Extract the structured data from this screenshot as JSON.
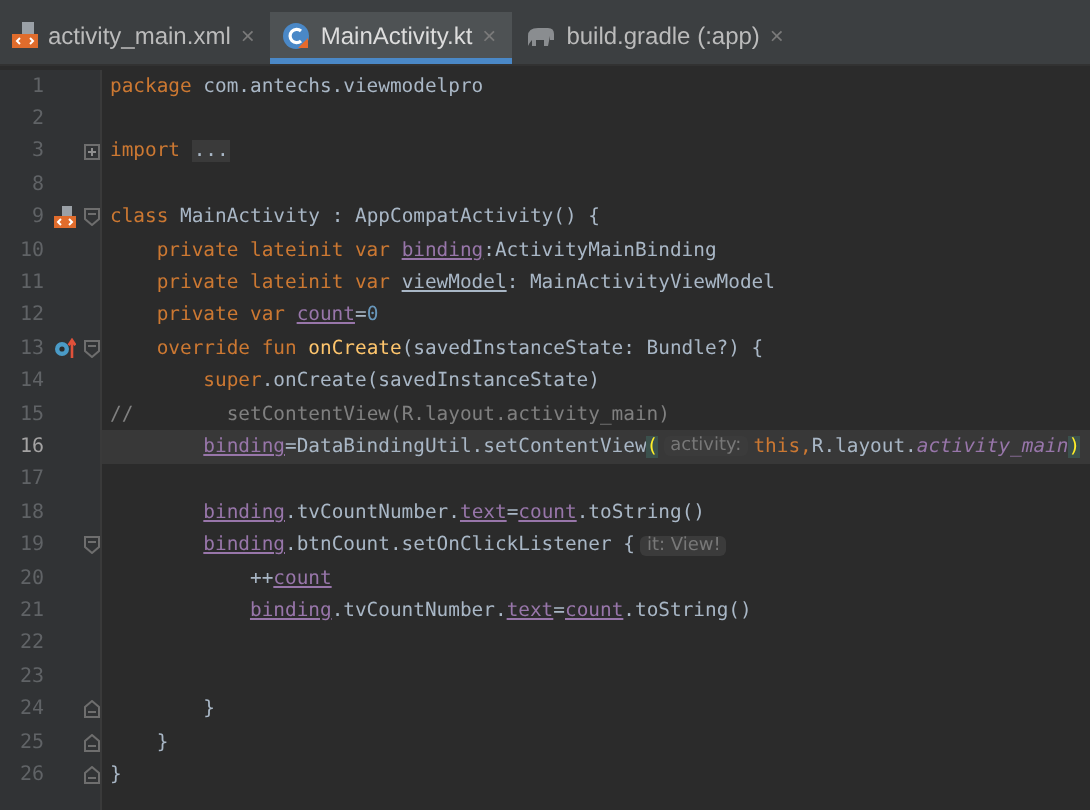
{
  "tabs": [
    {
      "label": "activity_main.xml",
      "kind": "layout",
      "close": "×",
      "selected": false
    },
    {
      "label": "MainActivity.kt",
      "kind": "kotlin",
      "close": "×",
      "selected": true
    },
    {
      "label": "build.gradle (:app)",
      "kind": "gradle",
      "close": "×",
      "selected": false
    }
  ],
  "lines": [
    {
      "num": "1",
      "current": false,
      "tokens": [
        {
          "kind": "kw",
          "text": "package"
        },
        {
          "kind": "space"
        },
        {
          "kind": "plain",
          "text": "com.antechs.viewmodelpro"
        }
      ]
    },
    {
      "num": "2",
      "current": false
    },
    {
      "num": "3",
      "current": false,
      "markers": [
        {
          "kind": "fold-expand"
        }
      ],
      "tokens": [
        {
          "kind": "kw",
          "text": "import"
        },
        {
          "kind": "space"
        },
        {
          "kind": "folded",
          "text": "..."
        }
      ]
    },
    {
      "num": "8",
      "current": false
    },
    {
      "num": "9",
      "current": false,
      "markers": [
        {
          "kind": "layout"
        },
        {
          "kind": "fold-start"
        }
      ],
      "tokens": [
        {
          "kind": "kw",
          "text": "class"
        },
        {
          "kind": "space"
        },
        {
          "kind": "plain",
          "text": "MainActivity : AppCompatActivity() {"
        }
      ]
    },
    {
      "num": "10",
      "current": false,
      "tokens": [
        {
          "kind": "tab"
        },
        {
          "kind": "kw",
          "text": "private lateinit var"
        },
        {
          "kind": "space"
        },
        {
          "kind": "prop",
          "text": "binding"
        },
        {
          "kind": "plain",
          "text": ":ActivityMainBinding"
        }
      ]
    },
    {
      "num": "11",
      "current": false,
      "tokens": [
        {
          "kind": "tab"
        },
        {
          "kind": "kw",
          "text": "private lateinit var"
        },
        {
          "kind": "space"
        },
        {
          "kind": "underlined",
          "text": "viewModel"
        },
        {
          "kind": "plain",
          "text": ": MainActivityViewModel"
        }
      ]
    },
    {
      "num": "12",
      "current": false,
      "tokens": [
        {
          "kind": "tab"
        },
        {
          "kind": "kw",
          "text": "private var"
        },
        {
          "kind": "space"
        },
        {
          "kind": "prop",
          "text": "count"
        },
        {
          "kind": "plain",
          "text": "="
        },
        {
          "kind": "num",
          "text": "0"
        }
      ]
    },
    {
      "num": "13",
      "current": false,
      "markers": [
        {
          "kind": "override"
        },
        {
          "kind": "fold-start"
        }
      ],
      "tokens": [
        {
          "kind": "tab"
        },
        {
          "kind": "kw",
          "text": "override fun"
        },
        {
          "kind": "space"
        },
        {
          "kind": "fn",
          "text": "onCreate"
        },
        {
          "kind": "plain",
          "text": "(savedInstanceState: Bundle?) {"
        }
      ]
    },
    {
      "num": "14",
      "current": false,
      "tokens": [
        {
          "kind": "tab"
        },
        {
          "kind": "tab"
        },
        {
          "kind": "kw",
          "text": "super"
        },
        {
          "kind": "plain",
          "text": ".onCreate(savedInstanceState)"
        }
      ]
    },
    {
      "num": "15",
      "current": false,
      "tokens": [
        {
          "kind": "comment",
          "text": "//"
        },
        {
          "kind": "tab"
        },
        {
          "kind": "tab"
        },
        {
          "kind": "comment",
          "text": "setContentView(R.layout.activity_main)"
        }
      ]
    },
    {
      "num": "16",
      "current": true,
      "tokens": [
        {
          "kind": "tab"
        },
        {
          "kind": "tab"
        },
        {
          "kind": "prop",
          "text": "binding"
        },
        {
          "kind": "plain",
          "text": "=DataBindingUtil.setContentView"
        },
        {
          "kind": "bracket",
          "text": "("
        },
        {
          "kind": "hint",
          "text": "activity:"
        },
        {
          "kind": "kw",
          "text": "this,"
        },
        {
          "kind": "plain",
          "text": "R.layout."
        },
        {
          "kind": "italic",
          "text": "activity_main"
        },
        {
          "kind": "bracket",
          "text": ")"
        }
      ]
    },
    {
      "num": "17",
      "current": false
    },
    {
      "num": "18",
      "current": false,
      "tokens": [
        {
          "kind": "tab"
        },
        {
          "kind": "tab"
        },
        {
          "kind": "prop",
          "text": "binding"
        },
        {
          "kind": "plain",
          "text": ".tvCountNumber."
        },
        {
          "kind": "prop",
          "text": "text"
        },
        {
          "kind": "plain",
          "text": "="
        },
        {
          "kind": "prop",
          "text": "count"
        },
        {
          "kind": "plain",
          "text": ".toString()"
        }
      ]
    },
    {
      "num": "19",
      "current": false,
      "markers": [
        {
          "kind": "fold-start"
        }
      ],
      "tokens": [
        {
          "kind": "tab"
        },
        {
          "kind": "tab"
        },
        {
          "kind": "prop",
          "text": "binding"
        },
        {
          "kind": "plain",
          "text": ".btnCount.setOnClickListener {"
        },
        {
          "kind": "hint",
          "text": "it: View!"
        }
      ]
    },
    {
      "num": "20",
      "current": false,
      "tokens": [
        {
          "kind": "tab"
        },
        {
          "kind": "tab"
        },
        {
          "kind": "tab"
        },
        {
          "kind": "plain",
          "text": "++"
        },
        {
          "kind": "prop",
          "text": "count"
        }
      ]
    },
    {
      "num": "21",
      "current": false,
      "tokens": [
        {
          "kind": "tab"
        },
        {
          "kind": "tab"
        },
        {
          "kind": "tab"
        },
        {
          "kind": "prop",
          "text": "binding"
        },
        {
          "kind": "plain",
          "text": ".tvCountNumber."
        },
        {
          "kind": "prop",
          "text": "text"
        },
        {
          "kind": "plain",
          "text": "="
        },
        {
          "kind": "prop",
          "text": "count"
        },
        {
          "kind": "plain",
          "text": ".toString()"
        }
      ]
    },
    {
      "num": "22",
      "current": false
    },
    {
      "num": "23",
      "current": false
    },
    {
      "num": "24",
      "current": false,
      "markers": [
        {
          "kind": "fold-end"
        }
      ],
      "tokens": [
        {
          "kind": "tab"
        },
        {
          "kind": "tab"
        },
        {
          "kind": "plain",
          "text": "}"
        }
      ]
    },
    {
      "num": "25",
      "current": false,
      "markers": [
        {
          "kind": "fold-end"
        }
      ],
      "tokens": [
        {
          "kind": "tab"
        },
        {
          "kind": "plain",
          "text": "}"
        }
      ]
    },
    {
      "num": "26",
      "current": false,
      "markers": [
        {
          "kind": "fold-end"
        }
      ],
      "tokens": [
        {
          "kind": "plain",
          "text": "}"
        }
      ]
    }
  ]
}
